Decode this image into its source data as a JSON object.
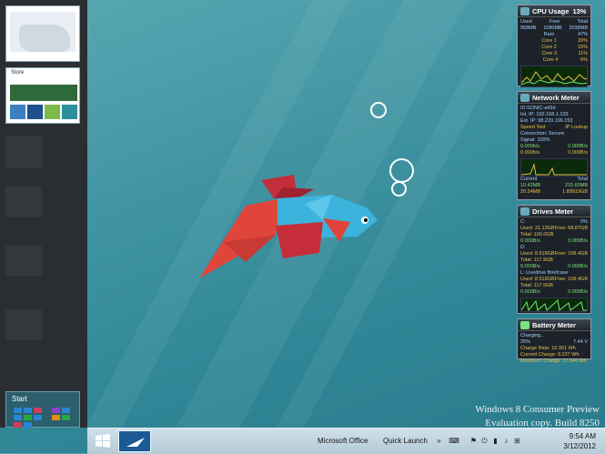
{
  "watermark": {
    "line1": "Windows 8 Consumer Preview",
    "line2": "Evaluation copy. Build 8250"
  },
  "switcher": {
    "thumbnails": [
      {
        "name": "maps-app"
      },
      {
        "name": "store-app",
        "label": "Store"
      }
    ],
    "start_label": "Start"
  },
  "gadgets": {
    "cpu": {
      "title": "CPU Usage",
      "value": "13%",
      "headers": [
        "Used",
        "Free",
        "Total"
      ],
      "mem_values": [
        "958MB",
        "1080MB",
        "2038MB"
      ],
      "ram_label": "Ram",
      "ram_pct": "47%",
      "cores": [
        {
          "label": "Core 1",
          "value": "20%"
        },
        {
          "label": "Core 2",
          "value": "15%"
        },
        {
          "label": "Core 3",
          "value": "11%"
        },
        {
          "label": "Core 4",
          "value": "6%"
        }
      ]
    },
    "network": {
      "title": "Network Meter",
      "id": "ID:SONIC-a43d",
      "int_ip": "Int. IP: 192.168.1.103",
      "ext_ip": "Ext. IP: 98.220.196.153",
      "speed_test": "Speed Test",
      "ip_lookup": "IP Lookup",
      "connection": "Connection: Secure",
      "signal": "Signal: 100%",
      "rates": [
        [
          "0.000b/s",
          "0.000B/s"
        ],
        [
          "0.000b/s",
          "0.000B/s"
        ]
      ],
      "current_label": "Current",
      "total_label": "Total",
      "totals": [
        [
          "10.42MB",
          "215.60MB"
        ],
        [
          "20.54MB",
          "1.89919GB"
        ]
      ]
    },
    "drives": {
      "title": "Drives Meter",
      "drive_c": "C:",
      "c_pct": "0%",
      "c_used": "Used: 31.13GB",
      "c_free": "Free: 68.87GB",
      "c_total": "Total: 100.0GB",
      "c_rates": [
        "0.000B/s",
        "0.000B/s"
      ],
      "drive_d": "D:",
      "d_used": "Used: 8.518GB",
      "d_free": "Free: 109.4GB",
      "d_total": "Total: 117.9GB",
      "d_rates": [
        "0.000B/s",
        "0.000B/s"
      ],
      "drive_l": "L: Livedrive Briefcase",
      "l_used": "Used: 8.518GB",
      "l_free": "Free: 109.4GB",
      "l_total": "Total: 117.9GB",
      "l_rates": [
        "0.000B/s",
        "0.000B/s"
      ]
    },
    "battery": {
      "title": "Battery Meter",
      "status": "Charging...",
      "pct": "25%",
      "voltage": "7.44 V",
      "charge_rate": "Charge Rate: 16.951 Wh",
      "current_charge": "Current Charge: 9.227 Wh",
      "max_charge": "Maximum Charge: 37.646 Wh"
    }
  },
  "taskbar": {
    "toolbars": [
      "Microsoft Office",
      "Quick Launch"
    ],
    "time": "9:54 AM",
    "date": "3/12/2012"
  },
  "colors": {
    "desktop": "#3f93a1",
    "fish_body": "#3bb3dc",
    "fish_fin": "#c62d3a",
    "fish_tail": "#e0453b"
  }
}
